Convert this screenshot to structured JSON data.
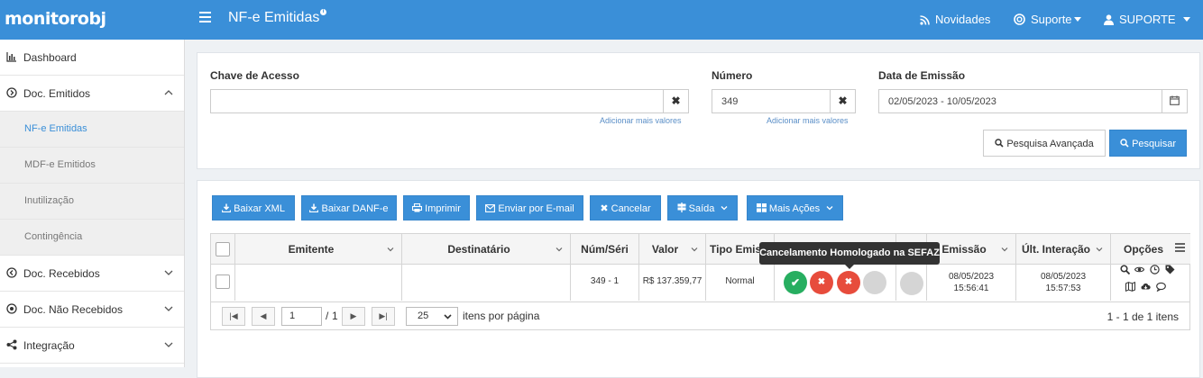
{
  "app": {
    "logo": "monitorobj",
    "page_title": "NF-e Emitidas"
  },
  "topnav": {
    "news": "Novidades",
    "support": "Suporte",
    "user": "SUPORTE"
  },
  "sidebar": {
    "items": [
      {
        "label": "Dashboard"
      },
      {
        "label": "Doc. Emitidos"
      },
      {
        "label": "NF-e Emitidas"
      },
      {
        "label": "MDF-e Emitidos"
      },
      {
        "label": "Inutilização"
      },
      {
        "label": "Contingência"
      },
      {
        "label": "Doc. Recebidos"
      },
      {
        "label": "Doc. Não Recebidos"
      },
      {
        "label": "Integração"
      }
    ]
  },
  "filters": {
    "access_key": {
      "label": "Chave de Acesso",
      "value": "",
      "add_more": "Adicionar mais valores"
    },
    "number": {
      "label": "Número",
      "value": "349",
      "add_more": "Adicionar mais valores"
    },
    "date": {
      "label": "Data de Emissão",
      "value": "02/05/2023 - 10/05/2023"
    },
    "advanced_search": "Pesquisa Avançada",
    "search": "Pesquisar"
  },
  "toolbar": {
    "download_xml": "Baixar XML",
    "download_danfe": "Baixar DANF-e",
    "print": "Imprimir",
    "email": "Enviar por E-mail",
    "cancel": "Cancelar",
    "exit": "Saída",
    "more": "Mais Ações"
  },
  "grid": {
    "columns": {
      "emitente": "Emitente",
      "destinatario": "Destinatário",
      "num_serie": "Núm/Séri",
      "valor": "Valor",
      "tipo": "Tipo Emis",
      "emissao": "Emissão",
      "ult_interacao": "Últ. Interação",
      "opcoes": "Opções"
    },
    "rows": [
      {
        "emitente": "",
        "destinatario": "",
        "num_serie": "349 - 1",
        "valor": "R$ 137.359,77",
        "tipo": "Normal",
        "emissao_date": "08/05/2023",
        "emissao_time": "15:56:41",
        "ult_date": "08/05/2023",
        "ult_time": "15:57:53"
      }
    ],
    "status_icons": [
      "check-icon",
      "x-icon",
      "x-icon",
      "empty",
      "empty"
    ],
    "colors": {
      "green": "#27ae60",
      "red": "#e74c3c",
      "grey": "#d5d5d5"
    },
    "tooltip": "Cancelamento Homologado na SEFAZ"
  },
  "pager": {
    "page": "1",
    "total_pages": "1",
    "page_prefix": "/",
    "page_size": "25",
    "per_page_label": "itens por página",
    "summary": "1 - 1 de 1 itens"
  }
}
